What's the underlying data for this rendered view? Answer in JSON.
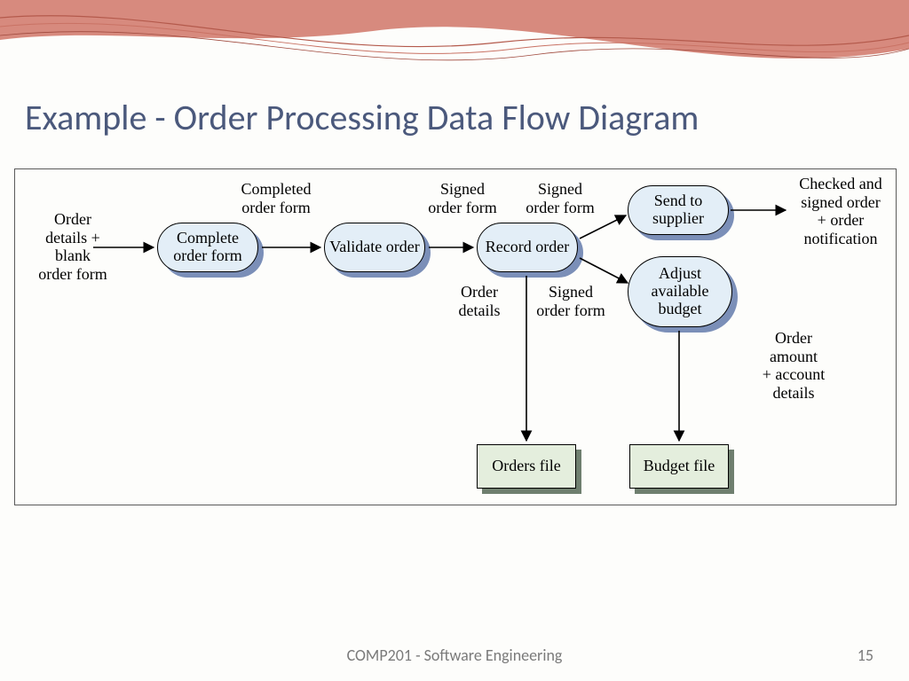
{
  "title": "Example - Order Processing Data Flow Diagram",
  "footer": {
    "course": "COMP201 - Software Engineering",
    "page": "15"
  },
  "nodes": {
    "complete": "Complete\norder form",
    "validate": "Validate\norder",
    "record": "Record\norder",
    "send": "Send to\nsupplier",
    "adjust": "Adjust\navailable\nbudget",
    "ordersFile": "Orders\nfile",
    "budgetFile": "Budget\nfile"
  },
  "labels": {
    "input": "Order\ndetails +\nblank\norder form",
    "completed": "Completed\norder form",
    "signed1": "Signed\norder form",
    "signed2": "Signed\norder form",
    "signed3": "Signed\norder form",
    "orderDetails": "Order\ndetails",
    "output": "Checked and\nsigned order\n+ order\nnotification",
    "orderAmount": "Order\namount\n+ account\ndetails"
  }
}
